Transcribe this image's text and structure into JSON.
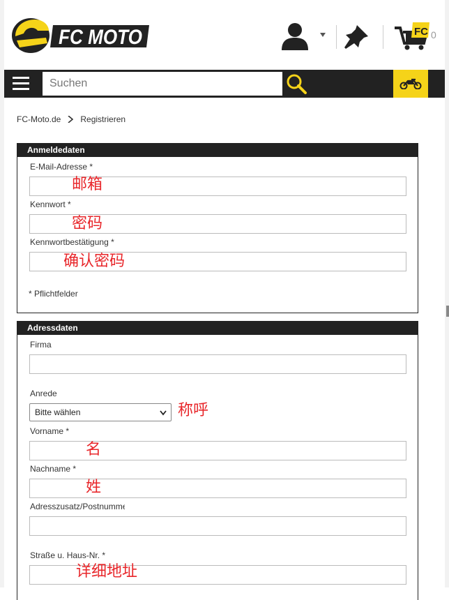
{
  "header": {
    "logo_text": "FC MOTO",
    "logo_badge": "FC",
    "cart_count": "0"
  },
  "search": {
    "placeholder": "Suchen"
  },
  "breadcrumb": {
    "home": "FC-Moto.de",
    "current": "Registrieren"
  },
  "login_panel": {
    "title": "Anmeldedaten",
    "email_label": "E-Mail-Adresse *",
    "email_note": "邮箱",
    "password_label": "Kennwort *",
    "password_note": "密码",
    "confirm_label": "Kennwortbestätigung *",
    "confirm_note": "确认密码",
    "required_hint": "* Pflichtfelder"
  },
  "address_panel": {
    "title": "Adressdaten",
    "company_label": "Firma",
    "salutation_label": "Anrede",
    "salutation_value": "Bitte wählen",
    "salutation_note": "称呼",
    "firstname_label": "Vorname *",
    "firstname_note": "名",
    "lastname_label": "Nachname *",
    "lastname_note": "姓",
    "addr_extra_label": "Adresszusatz/Postnummer",
    "street_label": "Straße u. Haus-Nr. *",
    "street_note": "详细地址"
  },
  "colors": {
    "brand_yellow": "#f5d319",
    "dark": "#222222",
    "annotation_red": "#e8262a"
  }
}
